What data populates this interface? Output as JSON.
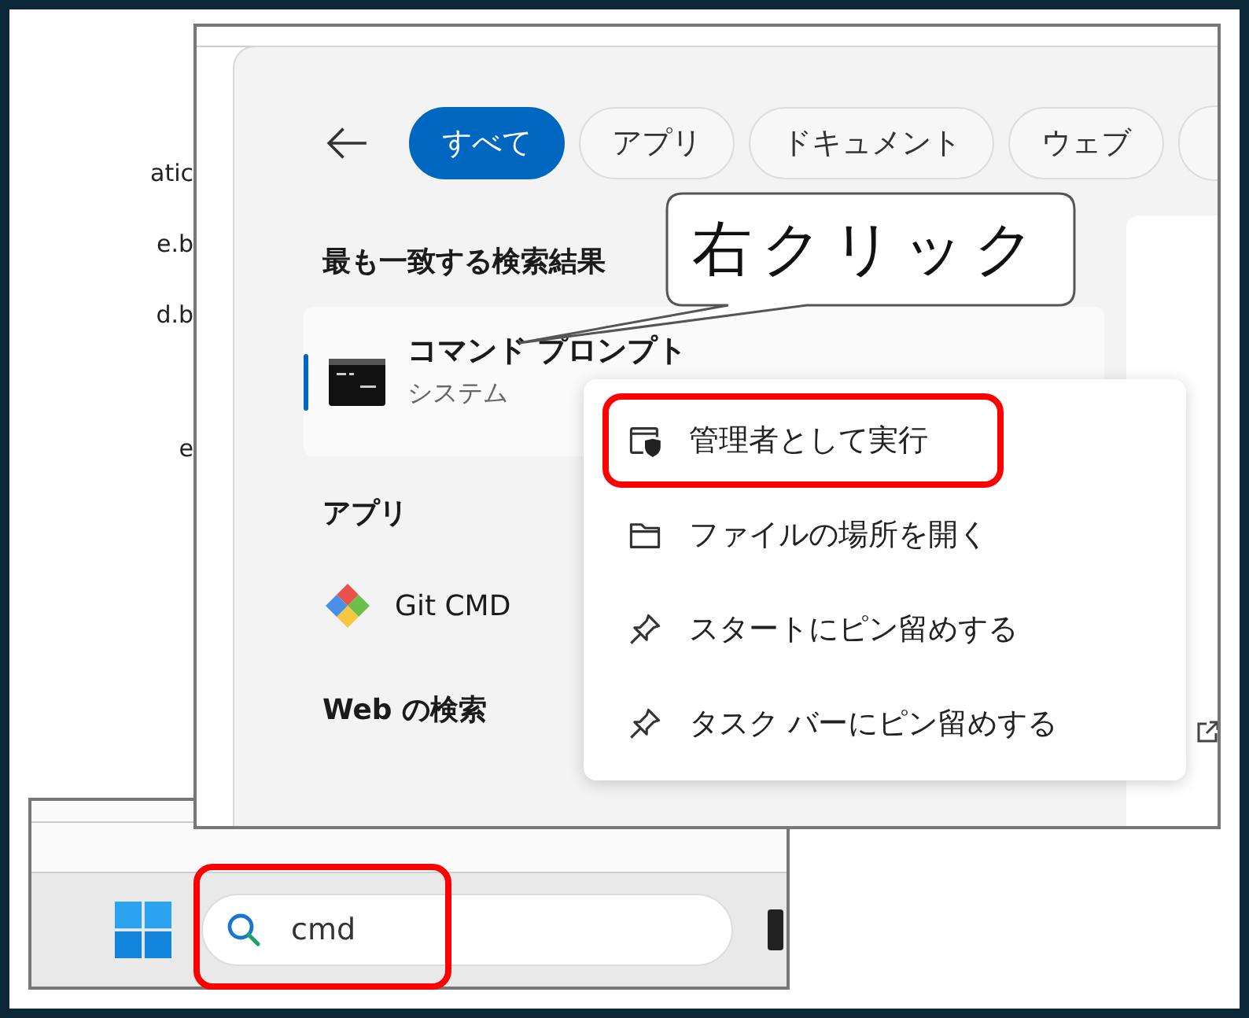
{
  "background_window": {
    "file_names": [
      "atic",
      "e.b",
      "d.b",
      "e"
    ]
  },
  "search_panel": {
    "tabs": [
      {
        "label": "すべて",
        "selected": true
      },
      {
        "label": "アプリ",
        "selected": false
      },
      {
        "label": "ドキュメント",
        "selected": false
      },
      {
        "label": "ウェブ",
        "selected": false
      }
    ],
    "best_match": {
      "heading": "最も一致する検索結果",
      "title": "コマンド プロンプト",
      "subtitle": "システム"
    },
    "apps": {
      "heading": "アプリ",
      "items": [
        "Git CMD"
      ]
    },
    "web_search": {
      "heading": "Web の検索"
    }
  },
  "context_menu": {
    "items": [
      {
        "kind": "admin",
        "label": "管理者として実行",
        "highlighted": true
      },
      {
        "kind": "folder",
        "label": "ファイルの場所を開く",
        "highlighted": false
      },
      {
        "kind": "pin",
        "label": "スタートにピン留めする",
        "highlighted": false
      },
      {
        "kind": "pin",
        "label": "タスク バーにピン留めする",
        "highlighted": false
      }
    ]
  },
  "callout": {
    "text": "右クリック"
  },
  "taskbar": {
    "search": {
      "value": "cmd",
      "highlighted": true
    }
  }
}
